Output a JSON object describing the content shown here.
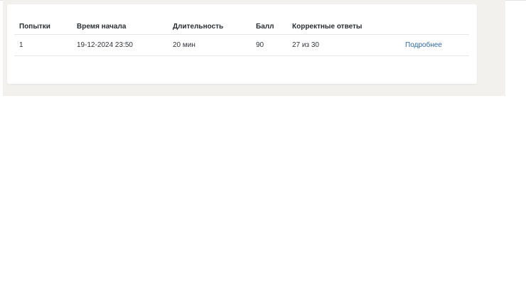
{
  "table": {
    "headers": [
      "Попытки",
      "Время начала",
      "Длительность",
      "Балл",
      "Корректные ответы",
      ""
    ],
    "rows": [
      {
        "attempt": "1",
        "start_time": "19-12-2024 23:50",
        "duration": "20 мин",
        "score": "90",
        "correct": "27 из 30",
        "details_label": "Подробнее"
      }
    ]
  },
  "colors": {
    "page_background": "#f2f1ee",
    "card_background": "#ffffff",
    "link": "#2f6aa5",
    "text": "#2f3338"
  }
}
